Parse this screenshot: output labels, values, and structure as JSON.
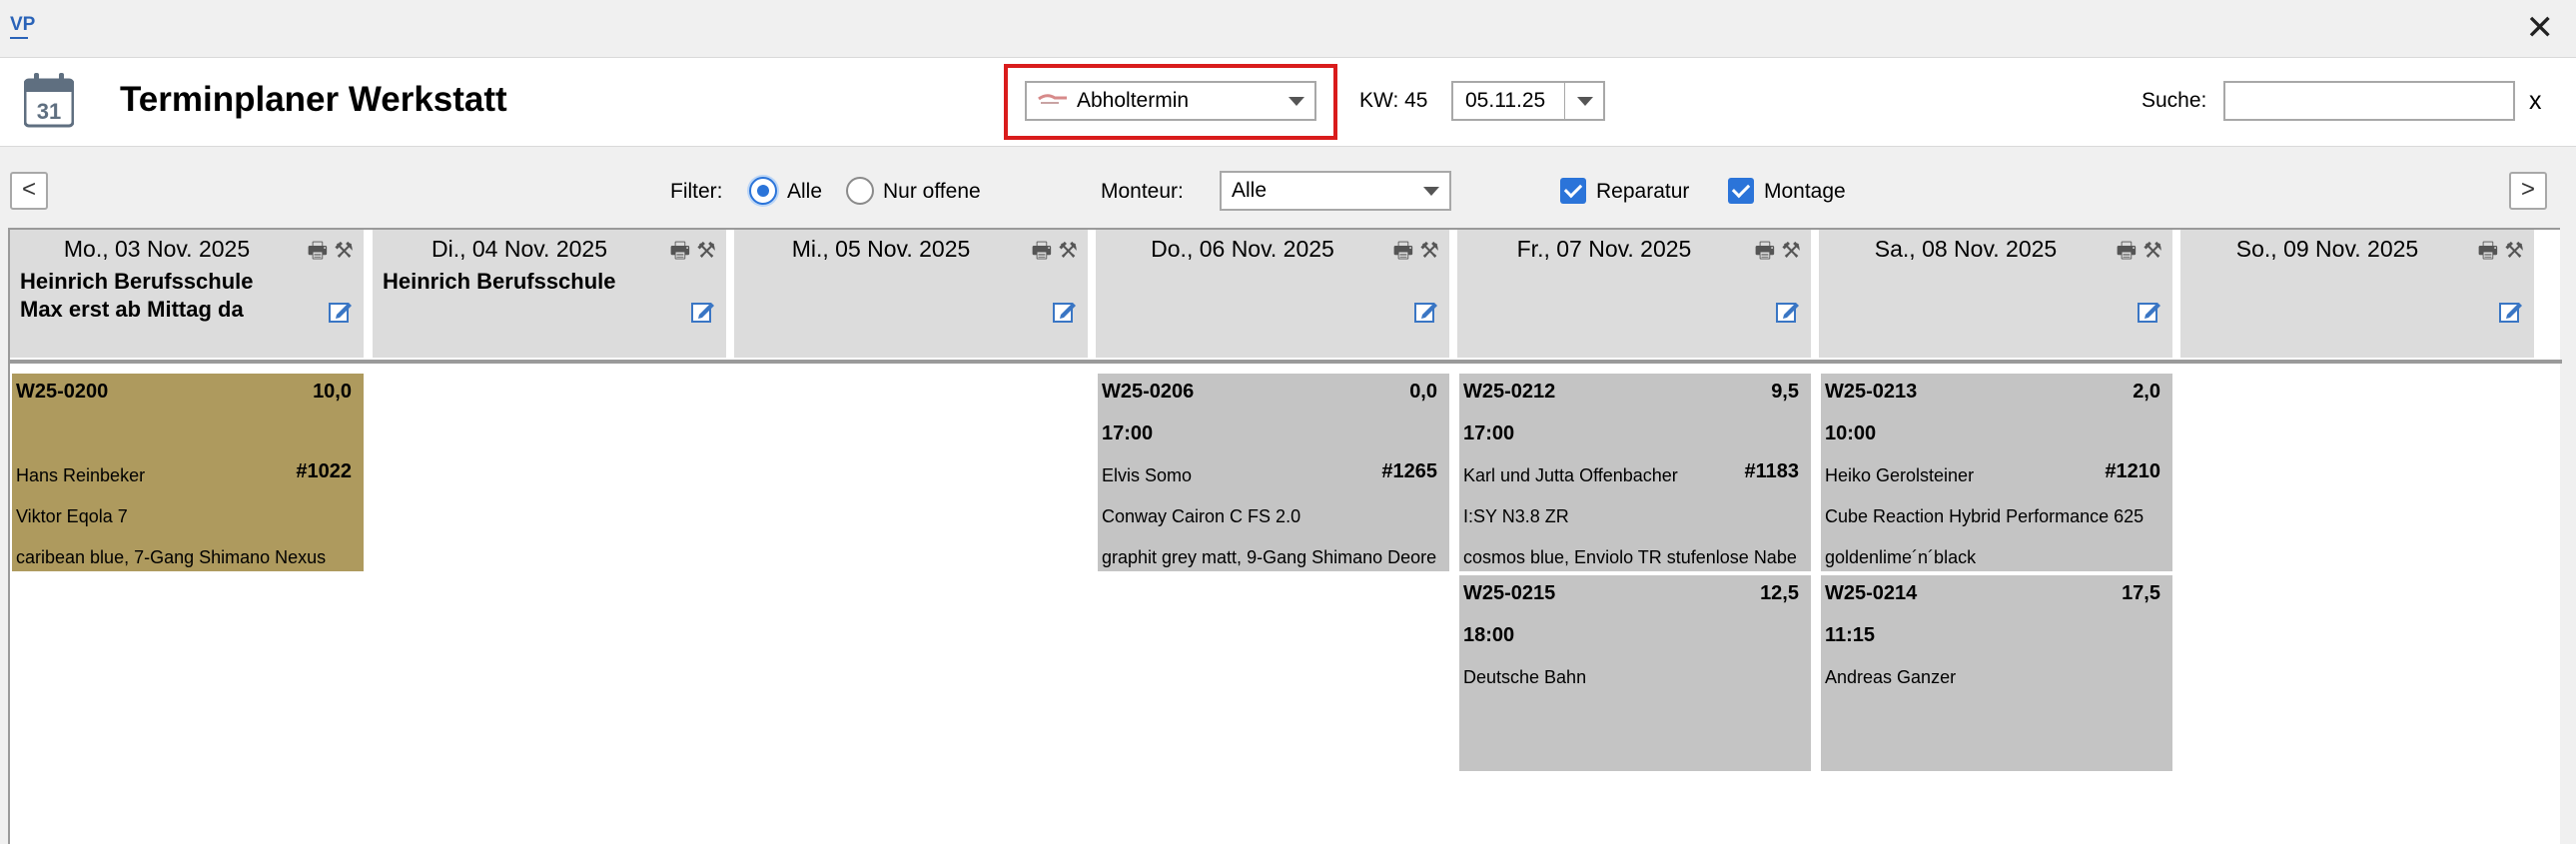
{
  "window": {
    "app_logo": "VP",
    "close_glyph": "✕"
  },
  "header": {
    "title": "Terminplaner Werkstatt",
    "calendar_icon_day": "31",
    "appointment_type": "Abholtermin",
    "kw_label": "KW: 45",
    "date_value": "05.11.25",
    "search_label": "Suche:",
    "search_value": "",
    "search_clear": "x"
  },
  "filterbar": {
    "prev": "<",
    "next": ">",
    "filter_label": "Filter:",
    "option_all": "Alle",
    "option_open": "Nur offene",
    "selected_filter": "Alle",
    "monteur_label": "Monteur:",
    "monteur_value": "Alle",
    "check_repair": "Reparatur",
    "check_assembly": "Montage"
  },
  "days": [
    {
      "date": "Mo., 03 Nov. 2025",
      "note1": "Heinrich Berufsschule",
      "note2": "Max erst ab Mittag da",
      "icons": true
    },
    {
      "date": "Di., 04 Nov. 2025",
      "note1": "Heinrich Berufsschule",
      "note2": "",
      "icons": true
    },
    {
      "date": "Mi., 05 Nov. 2025",
      "note1": "",
      "note2": "",
      "icons": true
    },
    {
      "date": "Do., 06 Nov. 2025",
      "note1": "",
      "note2": "",
      "icons": true
    },
    {
      "date": "Fr., 07 Nov. 2025",
      "note1": "",
      "note2": "",
      "icons": true
    },
    {
      "date": "Sa., 08 Nov. 2025",
      "note1": "",
      "note2": "",
      "icons": true
    },
    {
      "date": "So., 09 Nov. 2025",
      "note1": "",
      "note2": "",
      "icons": true
    }
  ],
  "cards": [
    {
      "id": "W25-0200",
      "hours": "10,0",
      "time": "",
      "customer": "Hans Reinbeker",
      "order": "#1022",
      "line2": "Viktor Eqola 7",
      "line3": "caribean blue, 7-Gang Shimano Nexus",
      "color": "gold"
    },
    {
      "id": "W25-0206",
      "hours": "0,0",
      "time": "17:00",
      "customer": "Elvis Somo",
      "order": "#1265",
      "line2": "Conway Cairon C FS 2.0",
      "line3": "graphit grey matt, 9-Gang Shimano Deore",
      "color": "grey"
    },
    {
      "id": "W25-0212",
      "hours": "9,5",
      "time": "17:00",
      "customer": "Karl und Jutta Offenbacher",
      "order": "#1183",
      "line2": "I:SY N3.8 ZR",
      "line3": "cosmos blue, Enviolo TR stufenlose Nabe",
      "color": "grey"
    },
    {
      "id": "W25-0215",
      "hours": "12,5",
      "time": "18:00",
      "customer": "Deutsche Bahn",
      "order": "",
      "line2": "",
      "line3": "",
      "color": "grey"
    },
    {
      "id": "W25-0213",
      "hours": "2,0",
      "time": "10:00",
      "customer": "Heiko Gerolsteiner",
      "order": "#1210",
      "line2": "Cube Reaction Hybrid Performance 625",
      "line3": "goldenlime´n´black",
      "color": "grey"
    },
    {
      "id": "W25-0214",
      "hours": "17,5",
      "time": "11:15",
      "customer": "Andreas Ganzer",
      "order": "",
      "line2": "",
      "line3": "",
      "color": "grey"
    }
  ],
  "colors": {
    "highlight": "#d91c1c",
    "accent": "#2b74d9",
    "card_gold": "#ae9a5e",
    "card_grey": "#c4c4c4"
  }
}
